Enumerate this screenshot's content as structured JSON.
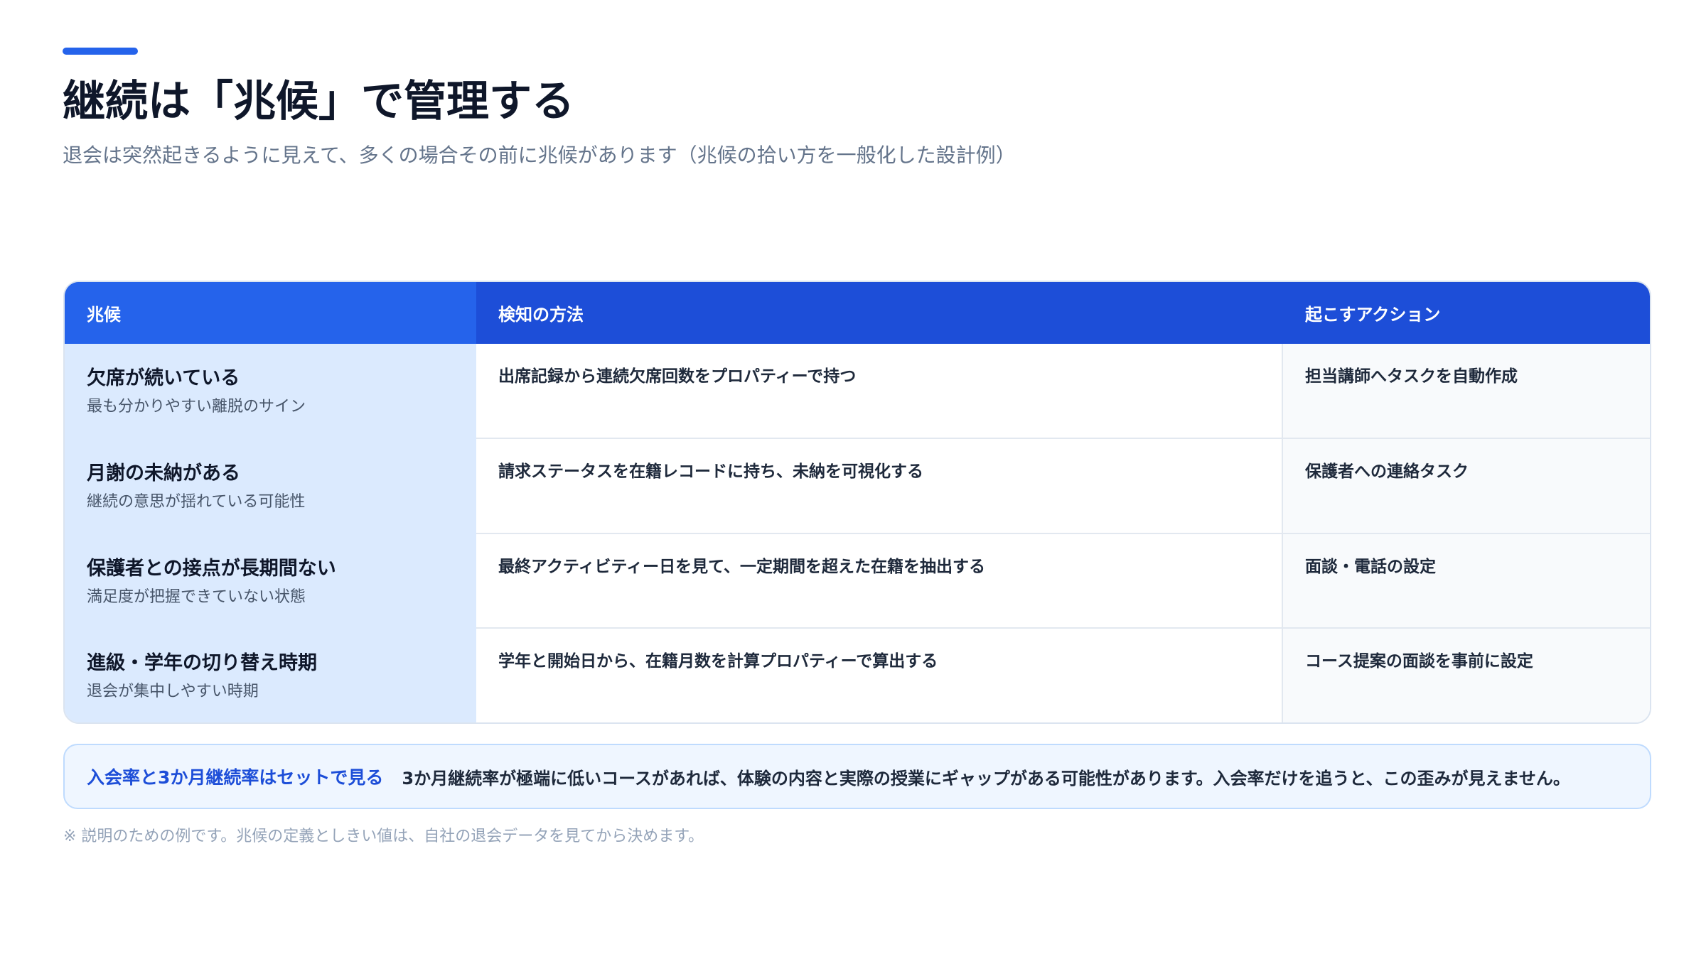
{
  "header": {
    "title": "継続は「兆候」で管理する",
    "subtitle": "退会は突然起きるように見えて、多くの場合その前に兆候があります（兆候の拾い方を一般化した設計例）"
  },
  "table": {
    "columns": [
      "兆候",
      "検知の方法",
      "起こすアクション"
    ],
    "rows": [
      {
        "sign": "欠席が続いている",
        "sign_desc": "最も分かりやすい離脱のサイン",
        "method": "出席記録から連続欠席回数をプロパティーで持つ",
        "action": "担当講師へタスクを自動作成"
      },
      {
        "sign": "月謝の未納がある",
        "sign_desc": "継続の意思が揺れている可能性",
        "method": "請求ステータスを在籍レコードに持ち、未納を可視化する",
        "action": "保護者への連絡タスク"
      },
      {
        "sign": "保護者との接点が長期間ない",
        "sign_desc": "満足度が把握できていない状態",
        "method": "最終アクティビティー日を見て、一定期間を超えた在籍を抽出する",
        "action": "面談・電話の設定"
      },
      {
        "sign": "進級・学年の切り替え時期",
        "sign_desc": "退会が集中しやすい時期",
        "method": "学年と開始日から、在籍月数を計算プロパティーで算出する",
        "action": "コース提案の面談を事前に設定"
      }
    ]
  },
  "callout": {
    "label": "入会率と3か月継続率はセットで見る",
    "text": "3か月継続率が極端に低いコースがあれば、体験の内容と実際の授業にギャップがある可能性があります。入会率だけを追うと、この歪みが見えません。"
  },
  "footnote": "※ 説明のための例です。兆候の定義としきい値は、自社の退会データを見てから決めます。",
  "colors": {
    "accent": "#2563eb",
    "header_dark": "#1d4ed8",
    "sign_column_bg": "#dbeafe",
    "callout_bg": "#eff6ff"
  }
}
